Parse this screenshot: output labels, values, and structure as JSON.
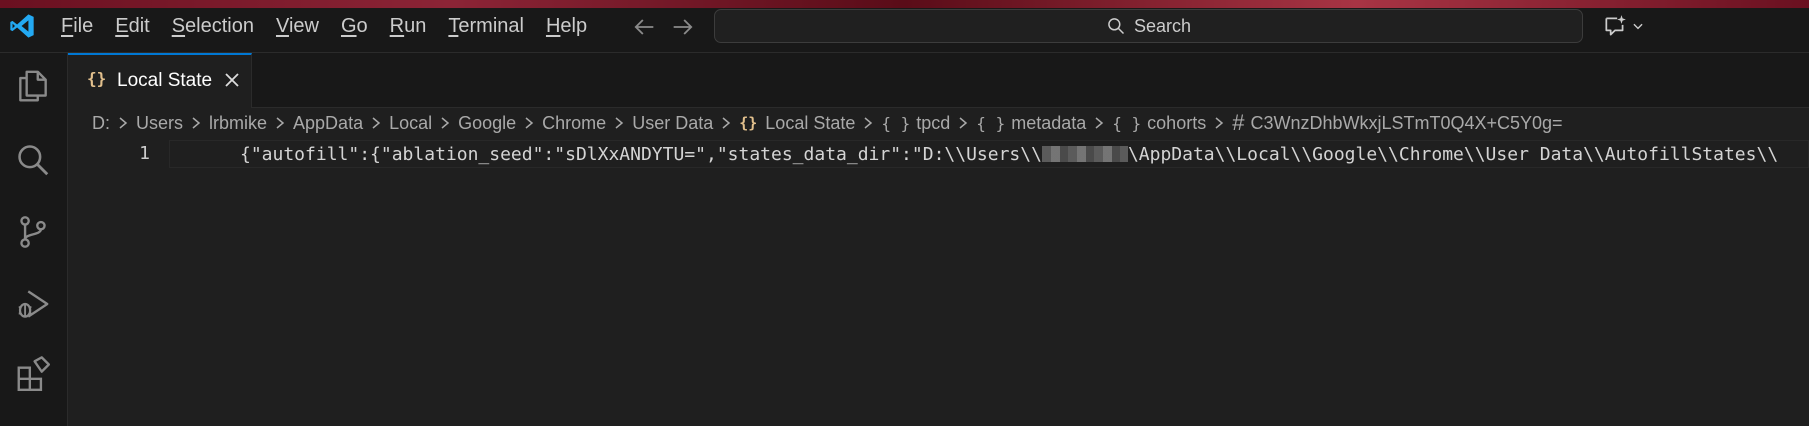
{
  "menu": {
    "items": [
      {
        "mn": "F",
        "rest": "ile"
      },
      {
        "mn": "E",
        "rest": "dit"
      },
      {
        "mn": "S",
        "rest": "election"
      },
      {
        "mn": "V",
        "rest": "iew"
      },
      {
        "mn": "G",
        "rest": "o"
      },
      {
        "mn": "R",
        "rest": "un"
      },
      {
        "mn": "T",
        "rest": "erminal"
      },
      {
        "mn": "H",
        "rest": "elp"
      }
    ]
  },
  "search": {
    "label": "Search"
  },
  "tab": {
    "label": "Local State",
    "icon_text": "{}"
  },
  "breadcrumb": {
    "drive": "D:",
    "folders": [
      "Users",
      "lrbmike",
      "AppData",
      "Local",
      "Google",
      "Chrome",
      "User Data"
    ],
    "file": "Local State",
    "file_icon": "{}",
    "objects": [
      "tpcd",
      "metadata",
      "cohorts"
    ],
    "object_icon": "{ }",
    "key": "C3WnzDhbWkxjLSTmT0Q4X+C5Y0g=",
    "key_icon": "#"
  },
  "editor": {
    "line_number": "1",
    "code_before": "{\"autofill\":{\"ablation_seed\":\"sDlXxANDYTU=\",\"states_data_dir\":\"D:\\\\Users\\\\",
    "code_after": "\\AppData\\\\Local\\\\Google\\\\Chrome\\\\User Data\\\\AutofillStates\\\\"
  },
  "colors": {
    "accent": "#0078d4",
    "brand": "#23a9f2",
    "json_icon": "#e2c08d",
    "background": "#1f1f1f",
    "chrome": "#181818"
  }
}
